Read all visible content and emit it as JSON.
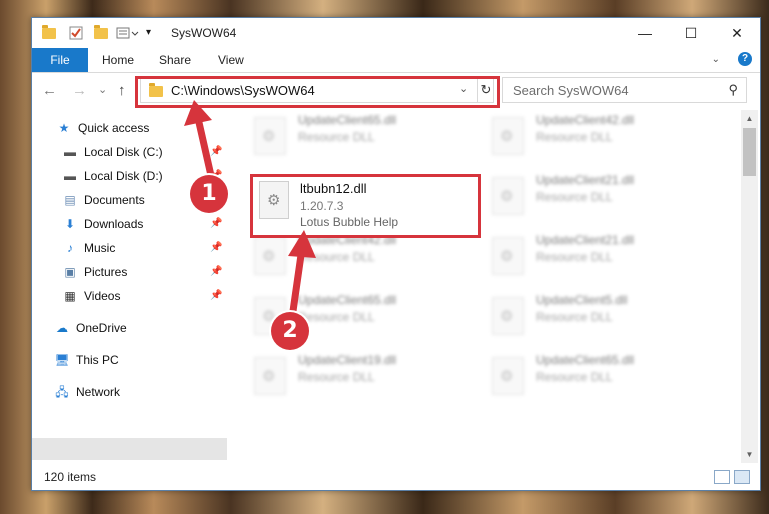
{
  "window": {
    "title": "SysWOW64",
    "controls": {
      "minimize": "—",
      "maximize": "☐",
      "close": "✕"
    }
  },
  "ribbon": {
    "tabs": [
      "File",
      "Home",
      "Share",
      "View"
    ]
  },
  "nav": {
    "back": "←",
    "forward": "→",
    "recent": "⌄",
    "up": "↑",
    "address": "C:\\Windows\\SysWOW64",
    "refresh": "↻",
    "search_placeholder": "Search SysWOW64"
  },
  "sidebar": {
    "items": [
      {
        "label": "Quick access",
        "icon": "star-icon"
      },
      {
        "label": "Local Disk (C:)",
        "icon": "drive-icon"
      },
      {
        "label": "Local Disk (D:)",
        "icon": "drive-icon"
      },
      {
        "label": "Documents",
        "icon": "documents-icon"
      },
      {
        "label": "Downloads",
        "icon": "download-icon"
      },
      {
        "label": "Music",
        "icon": "music-icon"
      },
      {
        "label": "Pictures",
        "icon": "pictures-icon"
      },
      {
        "label": "Videos",
        "icon": "videos-icon"
      },
      {
        "label": "OneDrive",
        "icon": "cloud-icon"
      },
      {
        "label": "This PC",
        "icon": "computer-icon"
      },
      {
        "label": "Network",
        "icon": "network-icon"
      }
    ]
  },
  "files": {
    "background": [
      {
        "name": "UpdateClient65.dll",
        "desc": "Resource DLL"
      },
      {
        "name": "UpdateClient42.dll",
        "desc": "Resource DLL"
      },
      {
        "name": "UpdateClient21.dll",
        "desc": "Resource DLL"
      },
      {
        "name": "UpdateClient42.dll",
        "desc": "Resource DLL"
      },
      {
        "name": "UpdateClient21.dll",
        "desc": "Resource DLL"
      },
      {
        "name": "UpdateClient65.dll",
        "desc": "Resource DLL"
      },
      {
        "name": "UpdateClient5.dll",
        "desc": "Resource DLL"
      },
      {
        "name": "UpdateClient19.dll",
        "desc": "Resource DLL"
      },
      {
        "name": "UpdateClient65.dll",
        "desc": "Resource DLL"
      }
    ],
    "featured": {
      "name": "ltbubn12.dll",
      "version": "1.20.7.3",
      "desc": "Lotus Bubble Help"
    }
  },
  "status": {
    "count": "120 items"
  },
  "annotations": {
    "step1": "1",
    "step2": "2"
  },
  "colors": {
    "accent": "#1979ca",
    "highlight": "#d6343c"
  }
}
